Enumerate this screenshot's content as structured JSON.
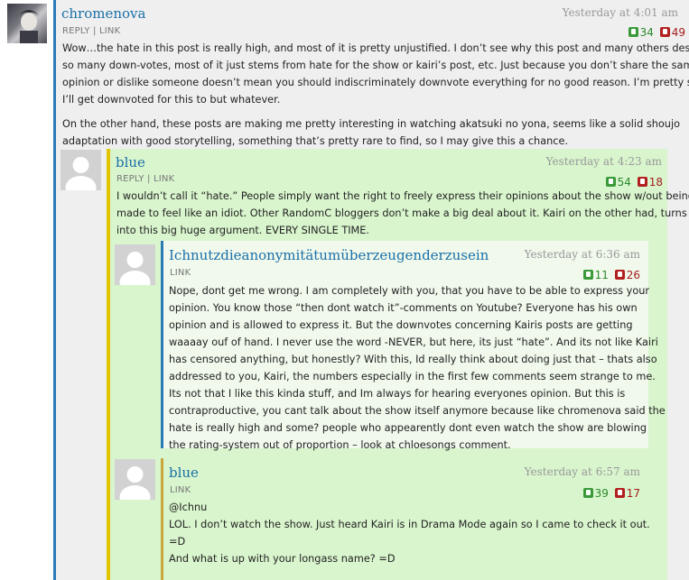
{
  "c1": {
    "author": "chromenova",
    "time": "Yesterday at 4:01 am",
    "reply": "REPLY",
    "link": "LINK",
    "up": "34",
    "down": "49",
    "para1": [
      "Wow…the hate in this post is really high, and most of it is pretty unjustified. I don’t see why this post and many others deserve",
      "so many down-votes, most of it just stems from hate for the show or kairi’s post, etc. Just because you don’t share the same",
      "opinion or dislike someone doesn’t mean you should indiscriminately downvote everything for no good reason. I’m pretty sure",
      "I’ll get downvoted for this to but whatever."
    ],
    "para2": [
      "On the other hand, these posts are making me pretty interesting in watching akatsuki no yona, seems like a solid shoujo",
      "adaptation with good storytelling, something that’s pretty rare to find, so I may give this a chance."
    ]
  },
  "c2": {
    "author": "blue",
    "time": "Yesterday at 4:23 am",
    "reply": "REPLY",
    "link": "LINK",
    "up": "54",
    "down": "18",
    "lines": [
      "I wouldn’t call it “hate.” People simply want the right to freely express their opinions about the show w/out being",
      "made to feel like an idiot. Other RandomC bloggers don’t make a big deal about it. Kairi on the other had, turns",
      "into this big huge argument. EVERY SINGLE TIME."
    ]
  },
  "c3": {
    "author": "Ichnutzdieanonymitätumüberzeugenderzusein",
    "time": "Yesterday at 6:36 am",
    "link": "LINK",
    "up": "11",
    "down": "26",
    "lines": [
      "Nope, dont get me wrong. I am completely with you, that you have to be able to express your",
      "opinion. You know those “then dont watch it”-comments on Youtube? Everyone has his own",
      "opinion and is allowed to express it. But the downvotes concerning Kairis posts are getting",
      "waaaay ouf of hand. I never use the word -NEVER, but here, its just “hate”. And its not like Kairi",
      "has censored anything, but honestly? With this, Id really think about doing just that – thats also",
      "addressed to you, Kairi, the numbers especially in the first few comments seem strange to me.",
      "Its not that I like this kinda stuff, and Im always for hearing everyones opinion. But this is",
      "contraproductive, you cant talk about the show itself anymore because like chromenova said the",
      "hate is really high and some? people who appearently dont even watch the show are blowing",
      "the rating-system out of proportion – look at chloesongs comment."
    ]
  },
  "c4": {
    "author": "blue",
    "time": "Yesterday at 6:57 am",
    "link": "LINK",
    "up": "39",
    "down": "17",
    "lines": [
      "@Ichnu",
      "LOL. I don’t watch the show. Just heard Kairi is in Drama Mode again so I came to check it out.",
      "=D",
      "And what is up with your longass name? =D"
    ]
  },
  "colors": {
    "c1_bg": "#efefef",
    "c1_border": "#2a7ab8",
    "c2_bg": "#d9f5cd",
    "c2_border": "#e3c400",
    "c3_bg": "#f0f9ec",
    "c3_border": "#2a7ab8",
    "c4_bg": "#d9f5cd",
    "c4_border": "#c9a63a"
  }
}
